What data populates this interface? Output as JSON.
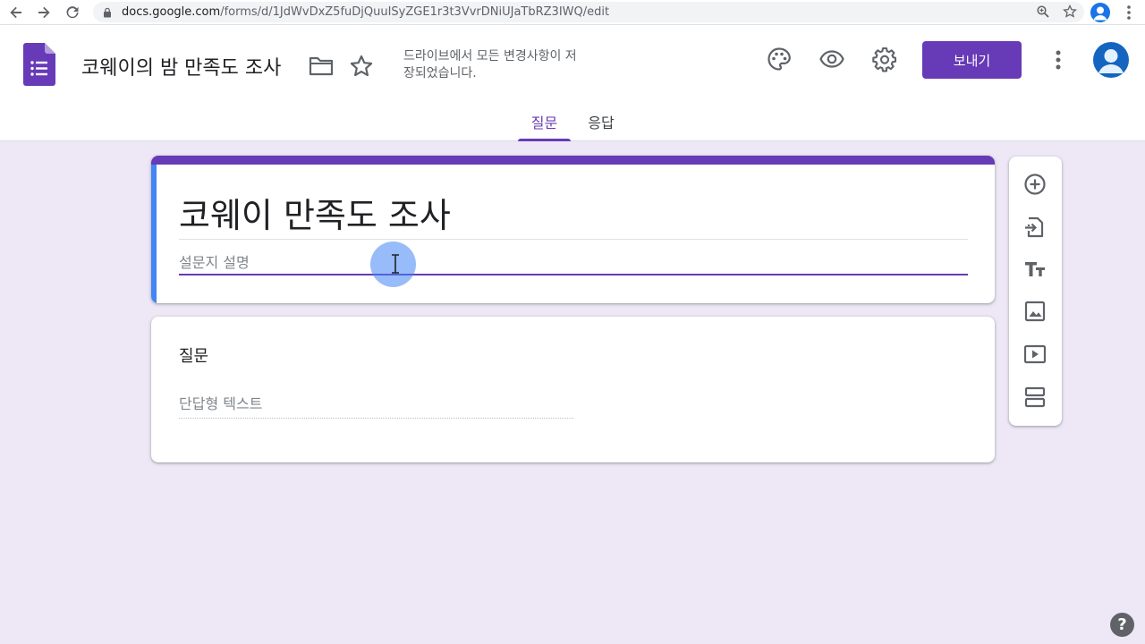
{
  "browser": {
    "url_host": "docs.google.com",
    "url_path": "/forms/d/1JdWvDxZ5fuDjQuuISyZGE1r3t3VvrDNiUJaTbRZ3IWQ/edit"
  },
  "header": {
    "doc_title": "코웨이의 밤 만족도 조사",
    "save_status": "드라이브에서 모든 변경사항이 저장되었습니다.",
    "send_label": "보내기",
    "icons": [
      "palette-icon",
      "preview-icon",
      "settings-icon",
      "more-icon"
    ]
  },
  "tabs": [
    {
      "label": "질문",
      "active": true
    },
    {
      "label": "응답",
      "active": false
    }
  ],
  "form": {
    "title": "코웨이 만족도 조사",
    "description_placeholder": "설문지 설명"
  },
  "question": {
    "title": "질문",
    "answer_placeholder": "단답형 텍스트"
  },
  "toolbar": [
    "add-question-icon",
    "import-questions-icon",
    "add-title-icon",
    "add-image-icon",
    "add-video-icon",
    "add-section-icon"
  ],
  "colors": {
    "accent": "#673ab7",
    "background": "#ede7f6",
    "left_accent": "#4285f4"
  },
  "help_label": "?"
}
